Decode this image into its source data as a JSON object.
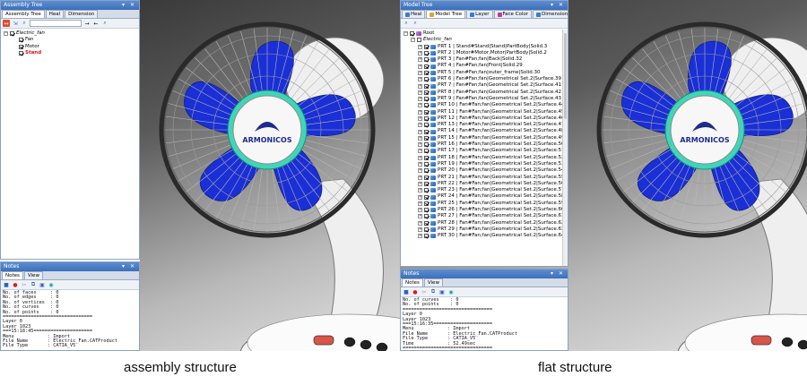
{
  "assembly": {
    "panel_title": "Assembly Tree",
    "tabs": [
      "Assembly Tree",
      "Heal",
      "Dimension"
    ],
    "tree": [
      {
        "level": 0,
        "label": "Electric_fan",
        "style": "ital",
        "expander": "−",
        "icon": "asm"
      },
      {
        "level": 1,
        "label": "Fan",
        "style": "",
        "expander": "",
        "icon": "part"
      },
      {
        "level": 1,
        "label": "Motor",
        "style": "",
        "expander": "",
        "icon": "part"
      },
      {
        "level": 1,
        "label": "Stand",
        "style": "red",
        "expander": "",
        "icon": "part"
      }
    ],
    "notes_title": "Notes",
    "notes_tabs": [
      "Notes",
      "View"
    ],
    "notes_lines": [
      "No. of faces     : 0",
      "No. of edges     : 0",
      "No. of vertices  : 0",
      "No. of curves    : 0",
      "No. of points    : 0",
      "================================",
      "Layer 0",
      "Layer 1023",
      "===15:18:45=====================",
      "Menu            : Import",
      "File Name       : Electric_Fan.CATProduct",
      "File Type       : CATIA_V5"
    ]
  },
  "model": {
    "panel_title": "Model Tree",
    "tabs": [
      "Heal",
      "Model Tree",
      "Layer",
      "Face Color",
      "Dimension"
    ],
    "root_label": "Root",
    "product_label": "Electric_fan",
    "parts": [
      "PRT 1 | Stand#Stand|Stand|PartBody|Solid.3",
      "PRT 2 | Motor#Motor,Motor|PartBody|Solid.2",
      "PRT 3 | Fan#Fan;fan|Back|Solid.32",
      "PRT 4 | Fan#Fan;fan|Front|Solid.29",
      "PRT 5 | Fan#Fan;fan|outer_frame|Solid.30",
      "PRT 6 | Fan#Fan;fan|Geometrical Set.2|Surface.39",
      "PRT 7 | Fan#Fan;fan|Geometrical Set.2|Surface.41",
      "PRT 8 | Fan#Fan;fan|Geometrical Set.2|Surface.42",
      "PRT 9 | Fan#Fan;fan|Geometrical Set.2|Surface.43",
      "PRT 10 | Fan#Fan;fan|Geometrical Set.2|Surface.44",
      "PRT 11 | Fan#Fan;fan|Geometrical Set.2|Surface.45",
      "PRT 12 | Fan#Fan;fan|Geometrical Set.2|Surface.46",
      "PRT 13 | Fan#Fan;fan|Geometrical Set.2|Surface.47",
      "PRT 14 | Fan#Fan;fan|Geometrical Set.2|Surface.48",
      "PRT 15 | Fan#Fan;fan|Geometrical Set.2|Surface.49",
      "PRT 16 | Fan#Fan;fan|Geometrical Set.2|Surface.50",
      "PRT 17 | Fan#Fan;fan|Geometrical Set.2|Surface.51",
      "PRT 18 | Fan#Fan;fan|Geometrical Set.2|Surface.52",
      "PRT 19 | Fan#Fan;fan|Geometrical Set.2|Surface.53",
      "PRT 20 | Fan#Fan;fan|Geometrical Set.2|Surface.54",
      "PRT 21 | Fan#Fan;fan|Geometrical Set.2|Surface.55",
      "PRT 22 | Fan#Fan;fan|Geometrical Set.2|Surface.56",
      "PRT 23 | Fan#Fan;fan|Geometrical Set.2|Surface.57",
      "PRT 24 | Fan#Fan;fan|Geometrical Set.2|Surface.58",
      "PRT 25 | Fan#Fan;fan|Geometrical Set.2|Surface.59",
      "PRT 26 | Fan#Fan;fan|Geometrical Set.2|Surface.60",
      "PRT 27 | Fan#Fan;fan|Geometrical Set.2|Surface.61",
      "PRT 28 | Fan#Fan;fan|Geometrical Set.2|Surface.62",
      "PRT 29 | Fan#Fan;fan|Geometrical Set.2|Surface.63",
      "PRT 30 | Fan#Fan;fan|Geometrical Set.2|Surface.64"
    ],
    "notes_title": "Notes",
    "notes_tabs": [
      "Notes",
      "View"
    ],
    "notes_lines": [
      "No. of curves    : 0",
      "No. of points    : 0",
      "================================",
      "Layer 0",
      "Layer 1023",
      "===15:16:35=====================",
      "Menu            : Import",
      "File Name       : Electric_Fan.CATProduct",
      "File Type       : CATIA_V5",
      "Time            : 52.49sec",
      "================================"
    ]
  },
  "fan_logo": "ARMONICOS",
  "captions": {
    "left": "assembly structure",
    "right": "flat structure"
  },
  "colors": {
    "blade": "#1a2fd6",
    "hub": "#3fd6b8",
    "panel_title": "#4a7ec6",
    "selected_red": "#e01010"
  }
}
